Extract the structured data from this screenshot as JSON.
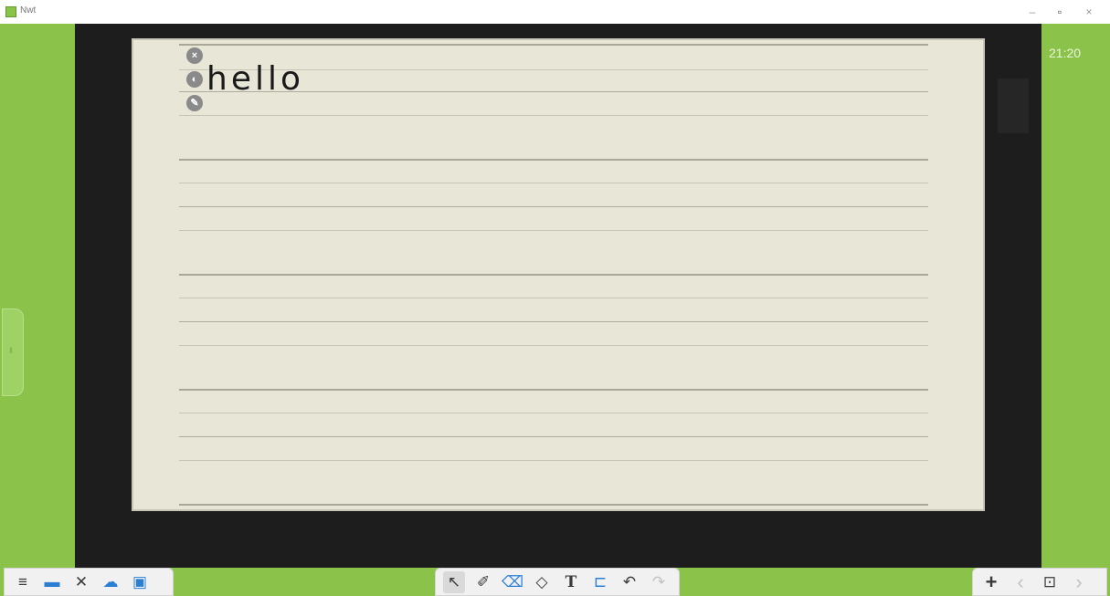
{
  "window": {
    "title": "Nwt",
    "controls": {
      "minimize": "–",
      "restore": "▫",
      "close": "×"
    }
  },
  "clock": "21:20",
  "left_handle": {
    "label": "‖"
  },
  "canvas": {
    "text_object": "hello",
    "object_controls": {
      "close": "×",
      "audio": "◐",
      "edit": "✎"
    }
  },
  "toolbar_left": [
    {
      "name": "menu-icon",
      "glyph": "≡"
    },
    {
      "name": "screen-icon",
      "glyph": "▬"
    },
    {
      "name": "tools-icon",
      "glyph": "✕"
    },
    {
      "name": "cloud-icon",
      "glyph": "☁"
    },
    {
      "name": "image-icon",
      "glyph": "▣"
    }
  ],
  "toolbar_center": [
    {
      "name": "select-tool-icon",
      "glyph": "↖"
    },
    {
      "name": "pen-tool-icon",
      "glyph": "✐"
    },
    {
      "name": "eraser-tool-icon",
      "glyph": "⌫"
    },
    {
      "name": "shape-tool-icon",
      "glyph": "◇"
    },
    {
      "name": "text-tool-icon",
      "glyph": "T"
    },
    {
      "name": "stamp-tool-icon",
      "glyph": "⊏"
    },
    {
      "name": "undo-icon",
      "glyph": "↶"
    },
    {
      "name": "redo-icon",
      "glyph": "↷"
    }
  ],
  "toolbar_right": [
    {
      "name": "add-page-icon",
      "glyph": "+"
    },
    {
      "name": "prev-page-icon",
      "glyph": "‹"
    },
    {
      "name": "page-list-icon",
      "glyph": "⊡"
    },
    {
      "name": "next-page-icon",
      "glyph": "›"
    }
  ],
  "colors": {
    "background_green": "#8bc34a",
    "canvas_dark": "#1d1d1d",
    "paper": "#e8e6d6",
    "accent_blue": "#2a7fd4"
  }
}
